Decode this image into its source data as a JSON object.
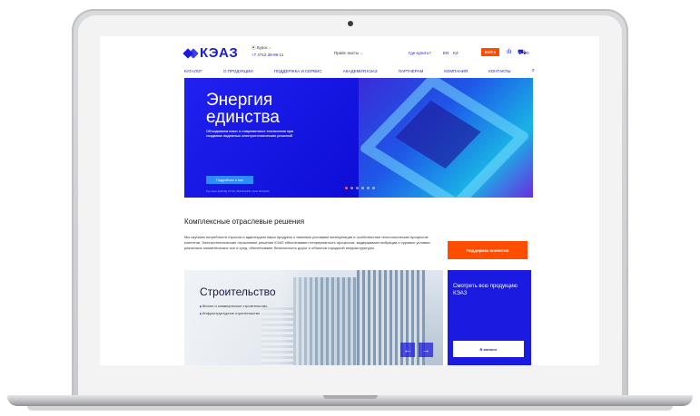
{
  "header": {
    "logo_text": "КЭАЗ",
    "city": "⦿ Курск ⌵",
    "phone": "+7 4712 39-99-11",
    "price_lists": "Прайс-листы ⌵",
    "where_to_buy": "Где купить?",
    "lang_en": "EN",
    "lang_kz": "KZ",
    "login": "Войти",
    "cart_count": "0"
  },
  "nav": {
    "items": [
      "КАТАЛОГ",
      "О ПРОДУКЦИИ",
      "ПОДДЕРЖКА И СЕРВИС",
      "АКАДЕМИЯ КЭАЗ",
      "ПАРТНЕРАМ",
      "КОМПАНИЯ",
      "КОНТАКТЫ"
    ]
  },
  "hero": {
    "title_line1": "Энергия",
    "title_line2": "единства",
    "subtitle": "Объединяем опыт и современные технологии при создании надежных электротехнических решений",
    "button": "Подробнее о нас",
    "legal": "Реклама ЕЭРИД ОГРН 4600101891  ИНН 4632200"
  },
  "section": {
    "title": "Комплексные отраслевые решения",
    "text": "Мы изучаем потребности отрасли и адаптируем наши продукты к тяжелым условиям эксплуатации и особенностям технологических процессов клиентов. Электротехнические отраслевые решения КЭАЗ обеспечивают непрерывность процессов, выдерживают вибрации и суровые условия различных климатических зон и сред, обеспечивают безопасность дорог и объектов городской инфраструктуры.",
    "support_button": "Поддержка клиентов"
  },
  "industry_card": {
    "title": "Строительство",
    "items": [
      "Жилое и коммерческое строительство",
      "Инфраструктурное строительство"
    ]
  },
  "promo": {
    "title": "Смотреть всю продукцию КЭАЗ",
    "button": "В каталог"
  },
  "colors": {
    "brand_blue": "#1a1ae0",
    "accent_orange": "#ff4d00"
  }
}
